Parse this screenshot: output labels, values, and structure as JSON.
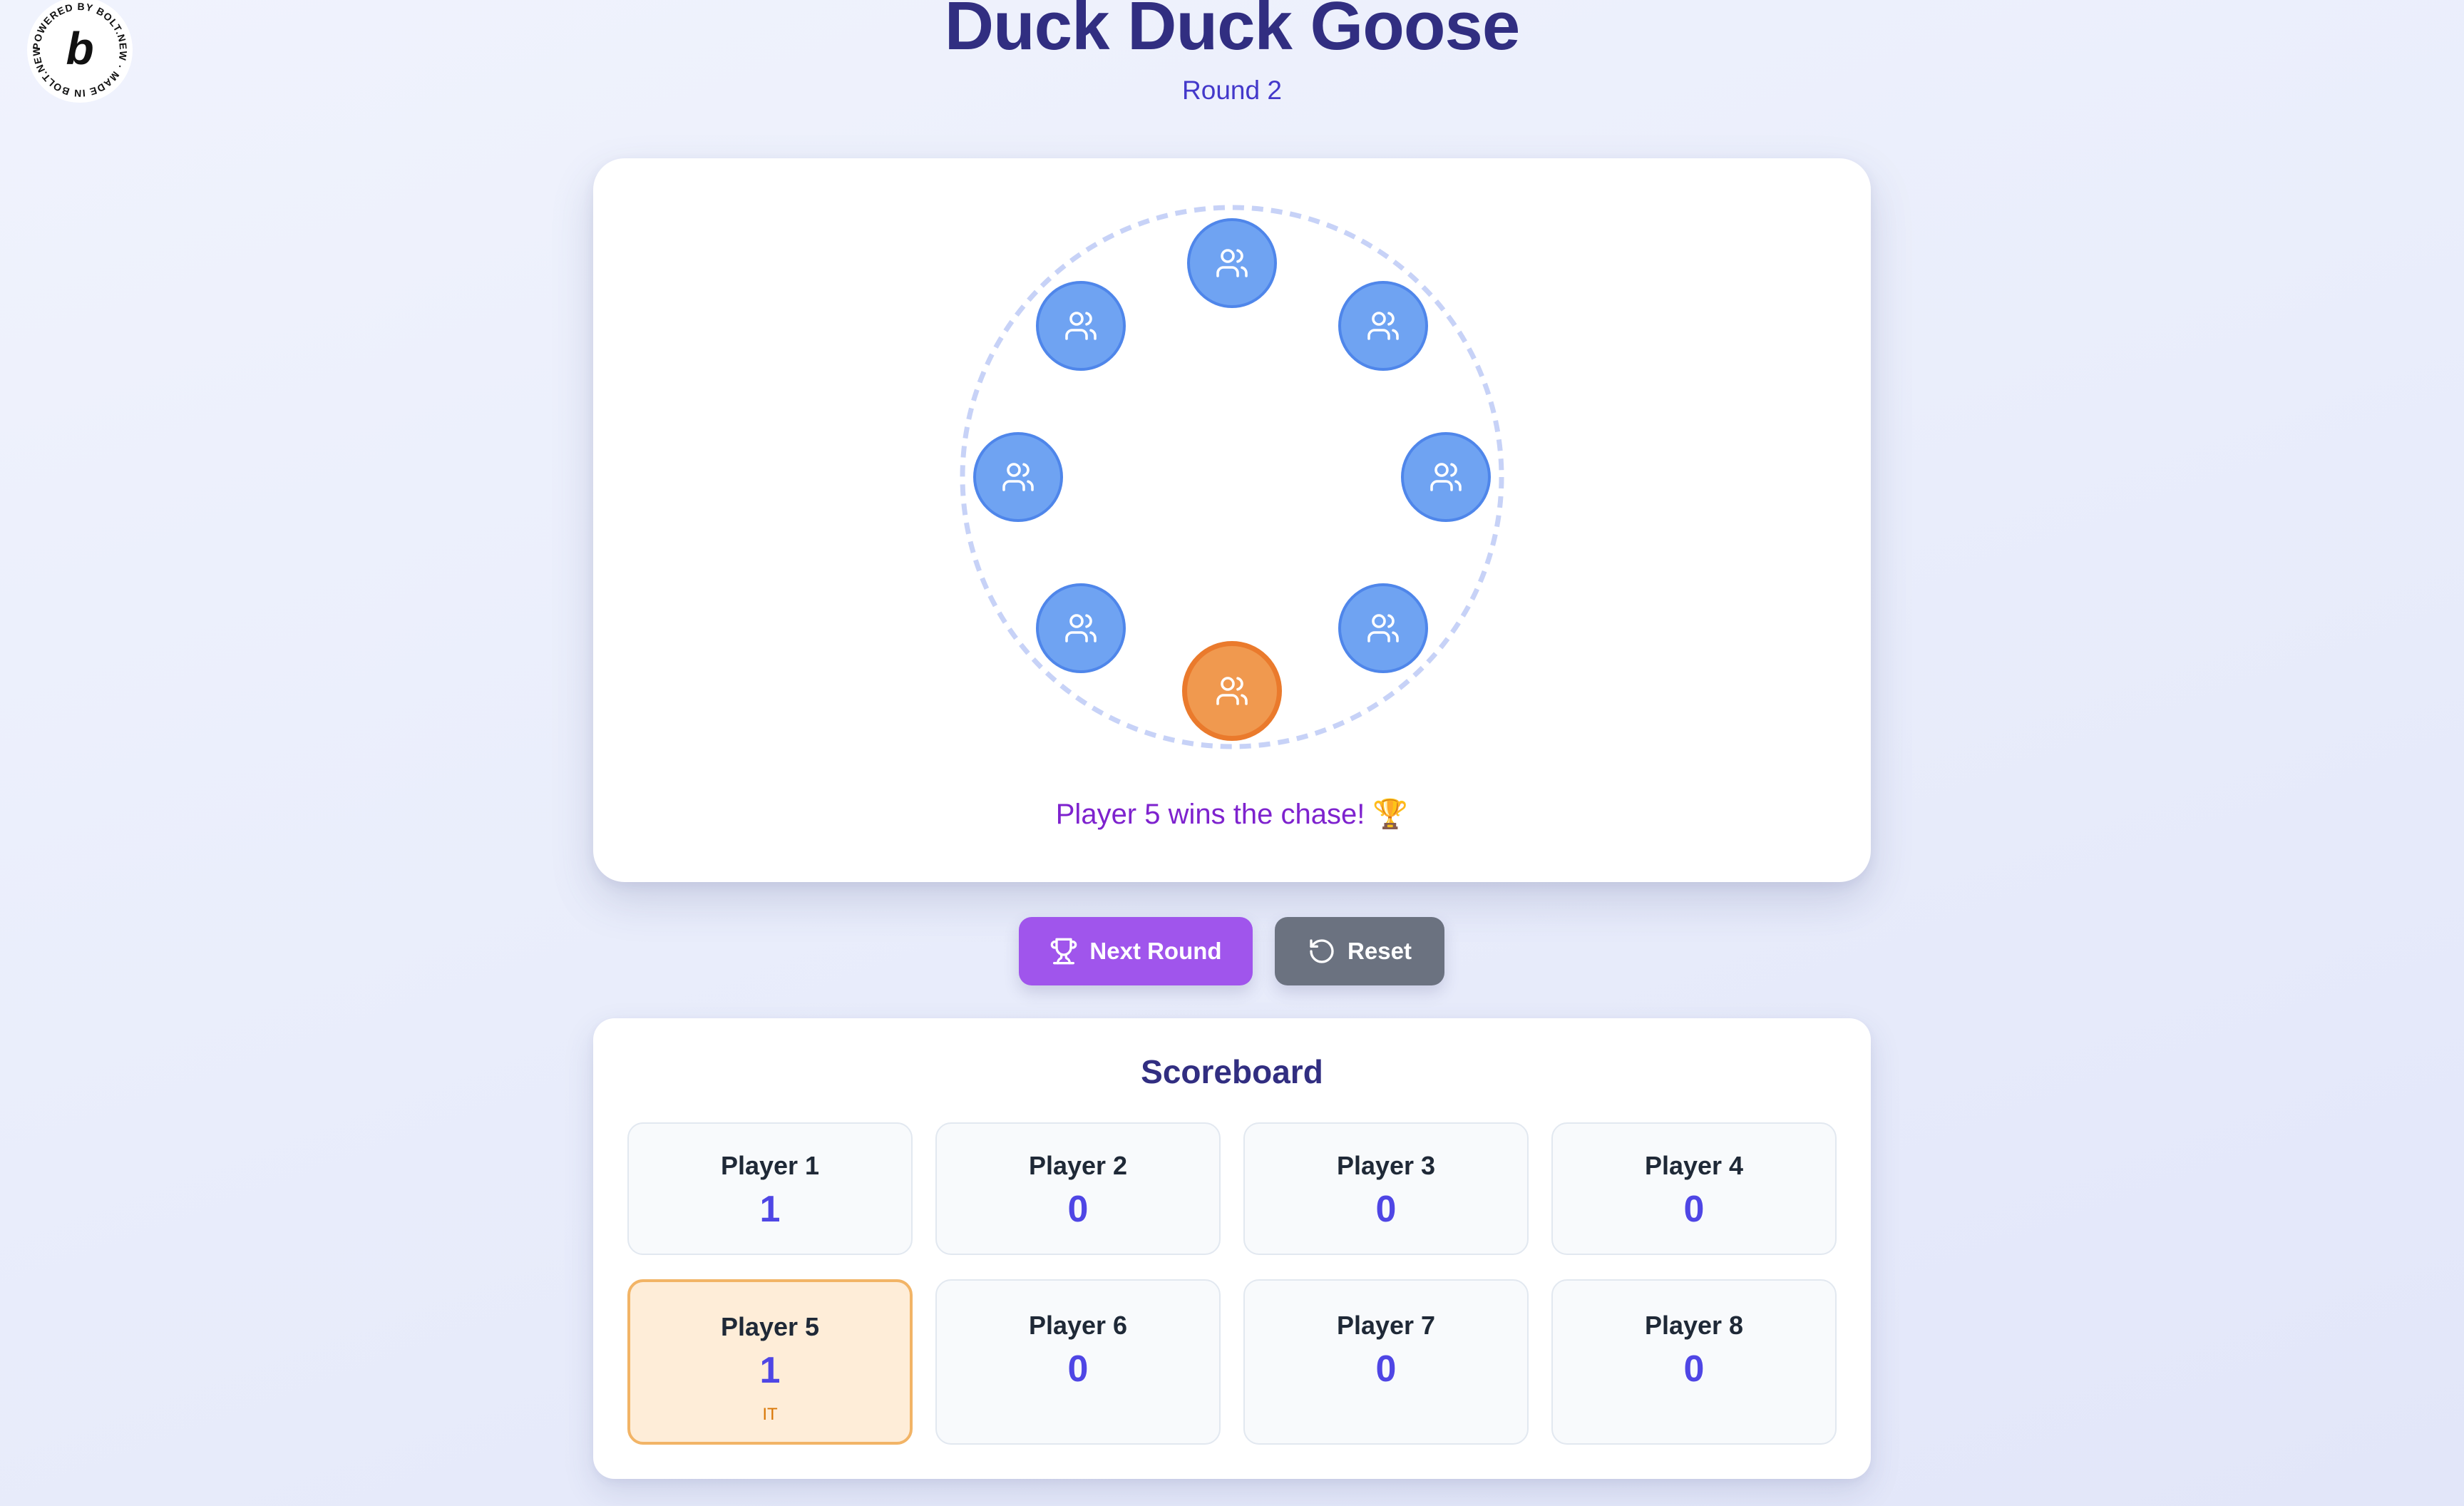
{
  "badge": {
    "ring_text": "POWERED BY BOLT.NEW · MADE IN BOLT.NEW ·",
    "logo_letter": "b"
  },
  "header": {
    "title": "Duck Duck Goose",
    "round_label": "Round 2"
  },
  "game": {
    "players": [
      {
        "name": "Player 1",
        "icon": "users-icon",
        "is_it": false
      },
      {
        "name": "Player 2",
        "icon": "users-icon",
        "is_it": false
      },
      {
        "name": "Player 3",
        "icon": "users-icon",
        "is_it": false
      },
      {
        "name": "Player 4",
        "icon": "users-icon",
        "is_it": false
      },
      {
        "name": "Player 5",
        "icon": "users-icon",
        "is_it": true
      },
      {
        "name": "Player 6",
        "icon": "users-icon",
        "is_it": false
      },
      {
        "name": "Player 7",
        "icon": "users-icon",
        "is_it": false
      },
      {
        "name": "Player 8",
        "icon": "users-icon",
        "is_it": false
      }
    ],
    "status_text": "Player 5 wins the chase! 🏆"
  },
  "controls": {
    "next_round": {
      "label": "Next Round",
      "icon": "trophy-icon"
    },
    "reset": {
      "label": "Reset",
      "icon": "rotate-ccw-icon"
    }
  },
  "scoreboard": {
    "title": "Scoreboard",
    "players": [
      {
        "name": "Player 1",
        "score": "1",
        "tag": ""
      },
      {
        "name": "Player 2",
        "score": "0",
        "tag": ""
      },
      {
        "name": "Player 3",
        "score": "0",
        "tag": ""
      },
      {
        "name": "Player 4",
        "score": "0",
        "tag": ""
      },
      {
        "name": "Player 5",
        "score": "1",
        "tag": "IT"
      },
      {
        "name": "Player 6",
        "score": "0",
        "tag": ""
      },
      {
        "name": "Player 7",
        "score": "0",
        "tag": ""
      },
      {
        "name": "Player 8",
        "score": "0",
        "tag": ""
      }
    ]
  },
  "colors": {
    "title": "#312e81",
    "node": "#6fa3f2",
    "node_it": "#f0994f",
    "status": "#7e22ce",
    "next_button": "#a055ec",
    "reset_button": "#6b7280",
    "score": "#4f46e5",
    "it_card": "#feedd8"
  }
}
